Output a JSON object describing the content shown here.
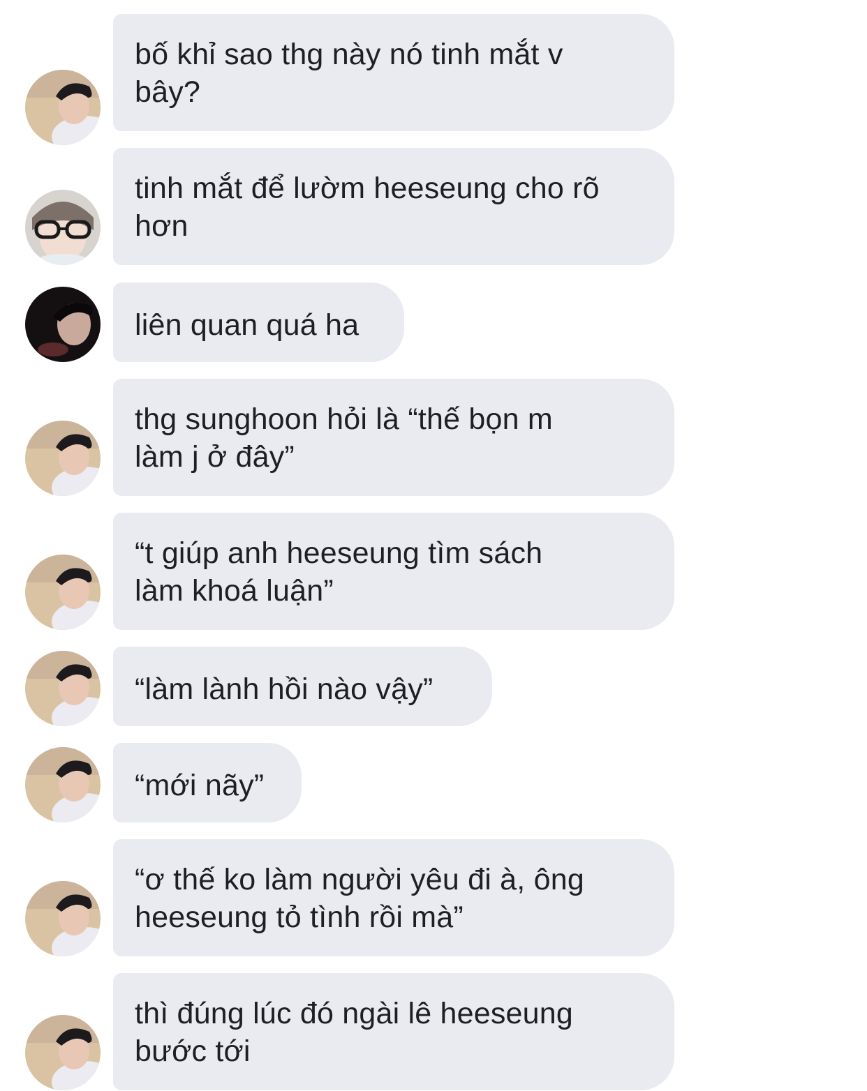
{
  "conversation": {
    "messages": [
      {
        "sender": "avatar-beach",
        "text": "bố khỉ sao thg này nó tinh mắt v\nbây?"
      },
      {
        "sender": "avatar-glasses",
        "text": "tinh mắt để lườm heeseung cho rõ\nhơn"
      },
      {
        "sender": "avatar-dark",
        "text": "liên quan quá ha"
      },
      {
        "sender": "avatar-beach",
        "text": "thg sunghoon hỏi là “thế bọn m\nlàm j ở đây”"
      },
      {
        "sender": "avatar-beach",
        "text": "“t giúp anh heeseung tìm sách\nlàm khoá luận”"
      },
      {
        "sender": "avatar-beach",
        "text": "“làm lành hồi nào vậy”"
      },
      {
        "sender": "avatar-beach",
        "text": "“mới nãy”"
      },
      {
        "sender": "avatar-beach",
        "text": "“ơ thế ko làm người yêu đi à, ông\nheeseung tỏ tình rồi mà”"
      },
      {
        "sender": "avatar-beach",
        "text": "thì đúng lúc đó ngài lê heeseung\nbước tới"
      }
    ]
  },
  "colors": {
    "bubble": "#e9ebf0",
    "text": "#1f1f23",
    "background": "#ffffff"
  }
}
